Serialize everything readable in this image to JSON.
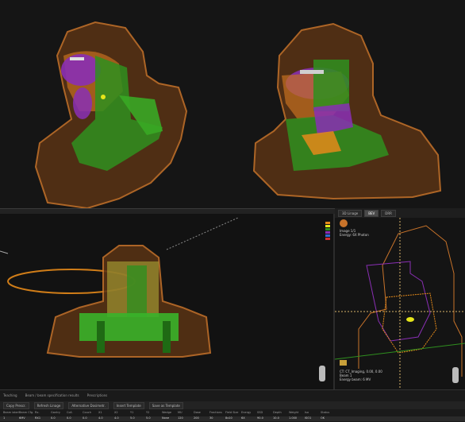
{
  "bev": {
    "tabs": [
      {
        "label": "3D Linage"
      },
      {
        "label": "BEV"
      },
      {
        "label": "DRR"
      }
    ],
    "info_top": [
      "Image 1/1",
      "Energy: 6X Photon"
    ],
    "info_bottom": [
      "CT: CT_Imaging, 0.00, 0.00",
      "Beam 1",
      "Energy beam: 6 MV"
    ]
  },
  "bottom": {
    "tabs": [
      "Teaching",
      "Beam / beam specification results",
      "Prescriptions"
    ],
    "toolbar": [
      "Copy Prescr.",
      "Refresh Linage",
      "Alternative Dosimetr.",
      "Insert Template",
      "Save as Template"
    ],
    "columns": [
      "Beam label",
      "Beam Cfg.",
      "Rx.",
      "Gantry",
      "Coll.",
      "Couch",
      "X1",
      "X2",
      "Y1",
      "Y2",
      "Wedge",
      "MU",
      "Dose",
      "Fractions",
      "Field Size",
      "Energy",
      "SSD",
      "Depth",
      "Weight",
      "Iso",
      "Status"
    ],
    "row": [
      "1",
      "6MV",
      "RX1",
      "0.0",
      "0.0",
      "0.0",
      "4.0",
      "4.0",
      "5.0",
      "5.0",
      "None",
      "120",
      "200",
      "30",
      "8x10",
      "6X",
      "90.0",
      "10.0",
      "1.000",
      "ISO1",
      "OK"
    ]
  },
  "colors": {
    "skin": "#c8732a",
    "tumor": "#8a2fb5",
    "organ_green": "#2f8f1f",
    "orange_struct": "#e58a1a",
    "background": "#0b0b0b"
  }
}
